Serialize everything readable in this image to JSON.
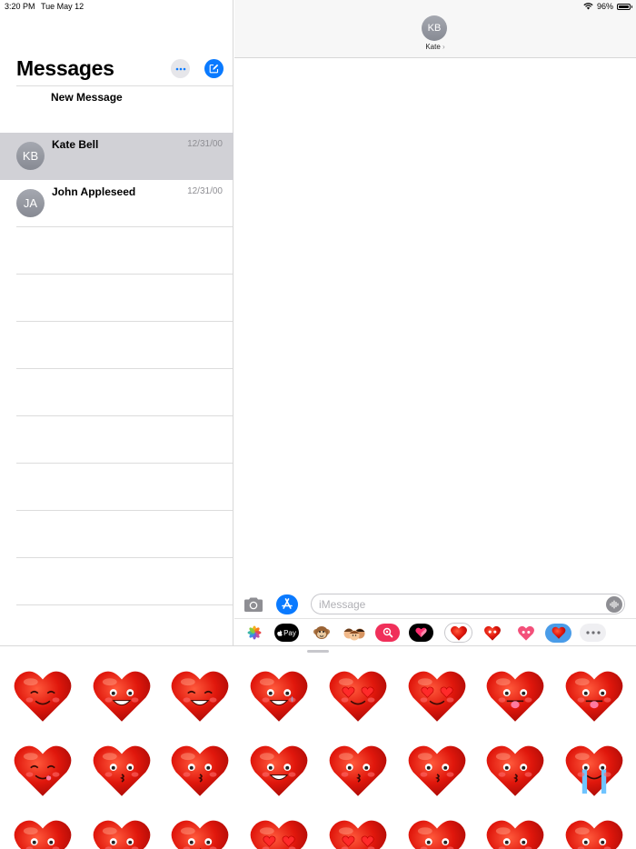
{
  "status_bar": {
    "time": "3:20 PM",
    "date": "Tue May 12",
    "battery": "96%",
    "battery_level": 0.96
  },
  "sidebar": {
    "title": "Messages",
    "new_message": "New Message",
    "conversations": [
      {
        "initials": "KB",
        "name": "Kate Bell",
        "date": "12/31/00",
        "selected": true
      },
      {
        "initials": "JA",
        "name": "John Appleseed",
        "date": "12/31/00",
        "selected": false
      }
    ]
  },
  "detail": {
    "contact_initials": "KB",
    "contact_name": "Kate",
    "chevron": "›",
    "input_placeholder": "iMessage",
    "input_value": ""
  },
  "app_strip": {
    "apps": [
      "photos-icon",
      "apple-pay-icon",
      "memoji-monkey-icon",
      "memoji-stickers-icon",
      "images-search-icon",
      "digital-touch-icon",
      "heart-stickers-app-icon",
      "heart-app-icon-2",
      "heart-app-icon-3",
      "heart-app-icon-4",
      "more-apps-icon"
    ],
    "apple_pay_label": "Pay",
    "selected": "heart-stickers-app-icon"
  },
  "stickers": [
    "heart-smiling-closed-eyes",
    "heart-grinning",
    "heart-happy-squint",
    "heart-nervous-sweat",
    "heart-eyes-kiss",
    "heart-eyes-kiss-2",
    "heart-tongue-out",
    "heart-tongue-out-2",
    "heart-yum",
    "heart-kiss",
    "heart-kiss-wink",
    "heart-big-smile",
    "heart-blush-kiss",
    "heart-kiss-closed-eyes",
    "heart-blow-kiss",
    "heart-crying",
    "heart-sad",
    "heart-wink-tongue",
    "heart-pout",
    "heart-eyes",
    "heart-eyes-grin",
    "heart-frown",
    "heart-frown-2",
    "heart-worried"
  ],
  "colors": {
    "accent": "#0a7aff",
    "selected_row": "#d1d1d6",
    "heart": "#e0170c"
  }
}
